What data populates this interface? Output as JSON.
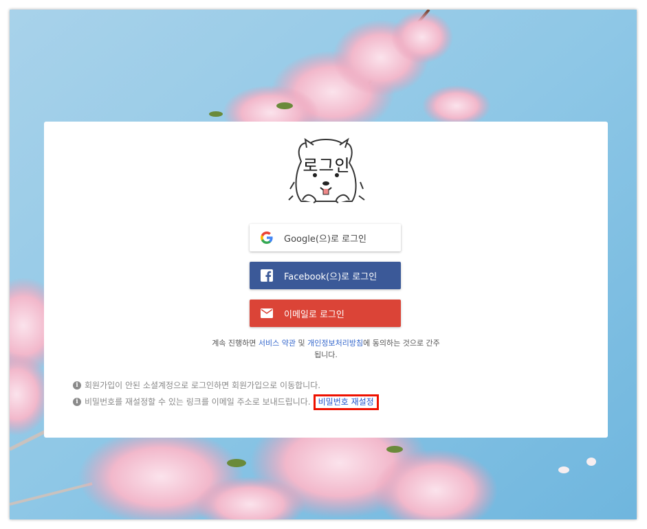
{
  "login": {
    "title": "로그인",
    "google_label": "Google(으)로 로그인",
    "facebook_label": "Facebook(으)로 로그인",
    "email_label": "이메일로 로그인",
    "terms_prefix": "계속 진행하면 ",
    "terms_link": "서비스 약관",
    "terms_and": " 및 ",
    "privacy_link": "개인정보처리방침",
    "terms_suffix": "에 동의하는 것으로 간주됩니다."
  },
  "notes": {
    "signup_note": "회원가입이 안된 소셜계정으로 로그인하면 회원가입으로 이동합니다.",
    "reset_note": "비밀번호를 재설정할 수 있는 링크를 이메일 주소로 보내드립니다.",
    "reset_link": "비밀번호 재설정"
  },
  "icons": {
    "google": "google-icon",
    "facebook": "facebook-icon",
    "email": "mail-icon",
    "info": "info-icon",
    "logo": "dog-mascot-logo"
  },
  "colors": {
    "facebook": "#3b5998",
    "email": "#db4437",
    "link": "#3366cc",
    "highlight": "#ee1100"
  }
}
